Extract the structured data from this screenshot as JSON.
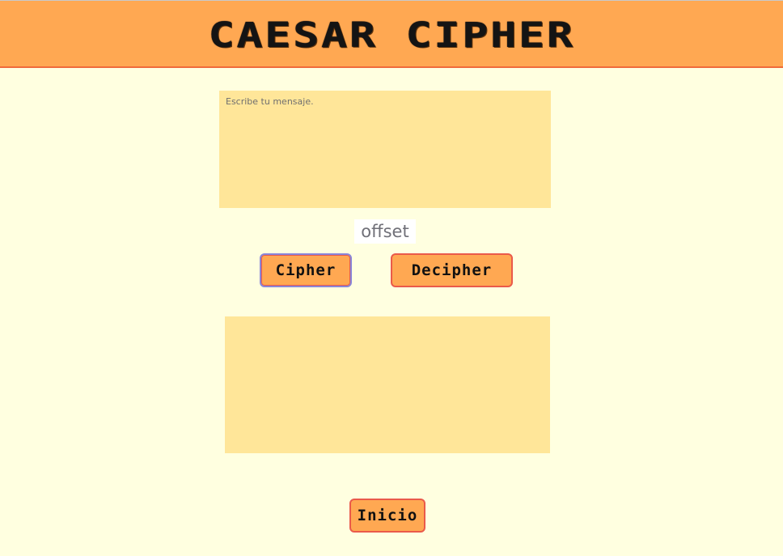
{
  "header": {
    "title": "CAESAR CIPHER"
  },
  "form": {
    "message_placeholder": "Escribe tu mensaje.",
    "message_value": "",
    "offset_placeholder": "offset",
    "offset_value": "",
    "output_value": ""
  },
  "buttons": {
    "cipher_label": "Cipher",
    "decipher_label": "Decipher",
    "inicio_label": "Inicio"
  },
  "colors": {
    "background": "#ffffe0",
    "header": "#ffa852",
    "header_border": "#f06a3a",
    "textarea": "#ffe699",
    "button": "#ffa852",
    "button_border": "#ea5a4a",
    "focus_outline": "#8a86d8"
  }
}
